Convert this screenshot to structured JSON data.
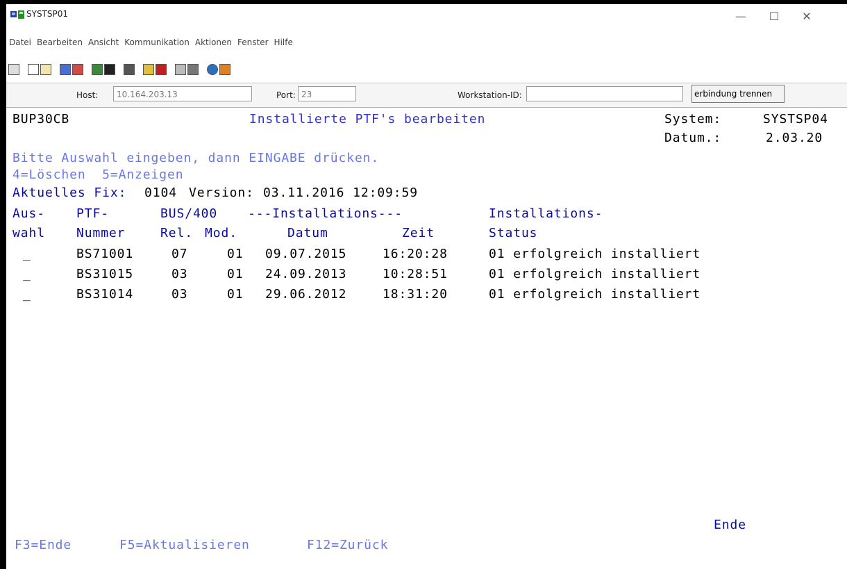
{
  "window": {
    "title": "SYSTSP01",
    "controls": [
      "—",
      "☐",
      "✕"
    ]
  },
  "menu": [
    "Datei",
    "Bearbeiten",
    "Ansicht",
    "Kommunikation",
    "Aktionen",
    "Fenster",
    "Hilfe"
  ],
  "connection": {
    "host_label": "Host:",
    "host_value": "10.164.203.13",
    "port_label": "Port:",
    "port_value": "23",
    "workstation_label": "Workstation-ID:",
    "workstation_value": "",
    "disconnect_label": "erbindung trennen"
  },
  "screen": {
    "program": "BUP30CB",
    "title": "Installierte PTF's bearbeiten",
    "system_label": "System:",
    "system_value": "SYSTSP04",
    "date_label": "Datum.:",
    "date_value": "2.03.20",
    "instruction": "Bitte Auswahl eingeben, dann EINGABE drücken.",
    "options": "4=Löschen  5=Anzeigen",
    "fix_label": "Aktuelles Fix:",
    "fix_value": "0104",
    "version_label": "Version:",
    "version_value": "03.11.2016 12:09:59",
    "header1": [
      "Aus-",
      "PTF-",
      "BUS/400",
      "---Installations---",
      "Installations-"
    ],
    "header2": [
      "wahl",
      "Nummer",
      "Rel.",
      "Mod.",
      "Datum",
      "Zeit",
      "Status"
    ],
    "rows": [
      {
        "sel": "_",
        "ptf": "BS71001",
        "rel": "07",
        "mod": "01",
        "date": "09.07.2015",
        "time": "16:20:28",
        "status": "01 erfolgreich installiert"
      },
      {
        "sel": "_",
        "ptf": "BS31015",
        "rel": "03",
        "mod": "01",
        "date": "24.09.2013",
        "time": "10:28:51",
        "status": "01 erfolgreich installiert"
      },
      {
        "sel": "_",
        "ptf": "BS31014",
        "rel": "03",
        "mod": "01",
        "date": "29.06.2012",
        "time": "18:31:20",
        "status": "01 erfolgreich installiert"
      }
    ],
    "end_label": "Ende",
    "fkeys": [
      "F3=Ende",
      "F5=Aktualisieren",
      "F12=Zurück"
    ]
  },
  "colors": {
    "field_blue": "#3333cc",
    "label_blue": "#0a0aa0",
    "light_blue": "#6a78e0",
    "text_black": "#000000"
  }
}
